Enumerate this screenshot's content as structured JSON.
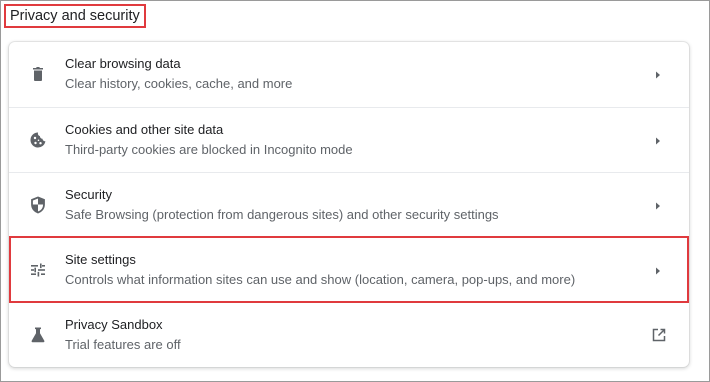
{
  "section": {
    "title": "Privacy and security"
  },
  "items": [
    {
      "title": "Clear browsing data",
      "subtitle": "Clear history, cookies, cache, and more",
      "icon": "trash-icon",
      "action_icon": "chevron-right-icon"
    },
    {
      "title": "Cookies and other site data",
      "subtitle": "Third-party cookies are blocked in Incognito mode",
      "icon": "cookie-icon",
      "action_icon": "chevron-right-icon"
    },
    {
      "title": "Security",
      "subtitle": "Safe Browsing (protection from dangerous sites) and other security settings",
      "icon": "shield-icon",
      "action_icon": "chevron-right-icon"
    },
    {
      "title": "Site settings",
      "subtitle": "Controls what information sites can use and show (location, camera, pop-ups, and more)",
      "icon": "tune-sliders-icon",
      "action_icon": "chevron-right-icon"
    },
    {
      "title": "Privacy Sandbox",
      "subtitle": "Trial features are off",
      "icon": "flask-icon",
      "action_icon": "open-in-new-icon"
    }
  ],
  "colors": {
    "highlight": "#e03a3e",
    "icon": "#5f6368",
    "title_text": "#202124",
    "subtitle_text": "#5f6368"
  }
}
